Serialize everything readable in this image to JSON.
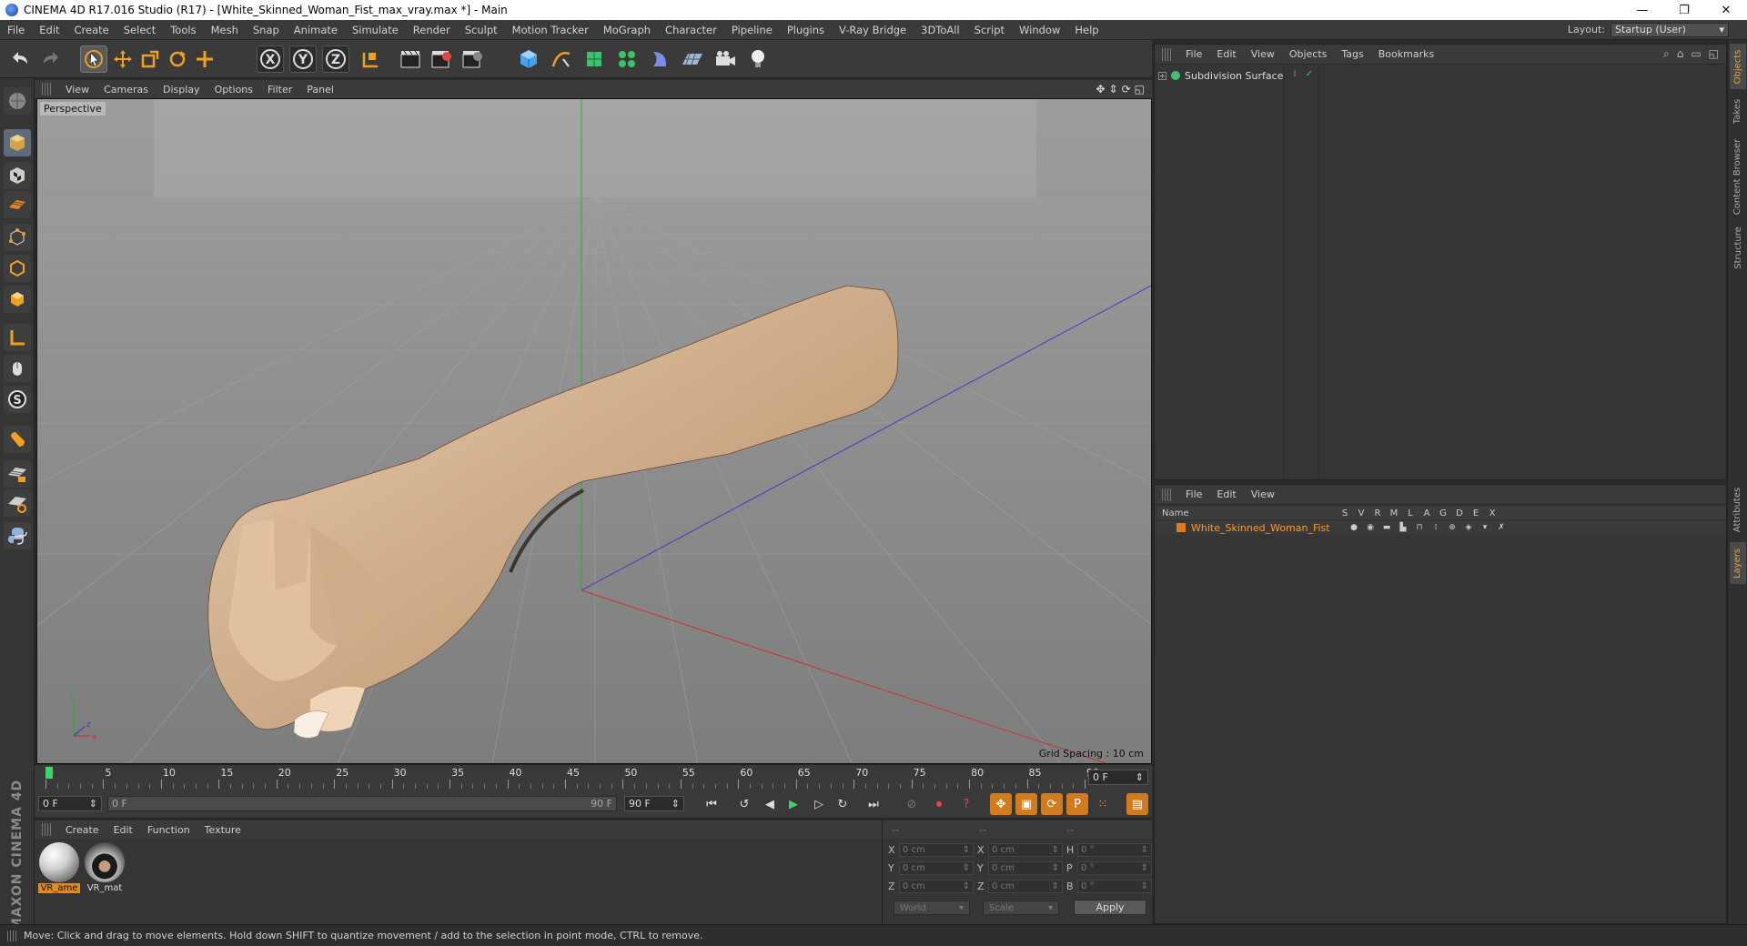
{
  "window": {
    "title": "CINEMA 4D R17.016 Studio (R17) - [White_Skinned_Woman_Fist_max_vray.max *] - Main",
    "minimize": "—",
    "restore": "❐",
    "close": "✕"
  },
  "menu": {
    "items": [
      "File",
      "Edit",
      "Create",
      "Select",
      "Tools",
      "Mesh",
      "Snap",
      "Animate",
      "Simulate",
      "Render",
      "Sculpt",
      "Motion Tracker",
      "MoGraph",
      "Character",
      "Pipeline",
      "Plugins",
      "V-Ray Bridge",
      "3DToAll",
      "Script",
      "Window",
      "Help"
    ],
    "layout_label": "Layout:",
    "layout_value": "Startup (User)"
  },
  "toolbar": {
    "icons": [
      "undo-icon",
      "redo-icon",
      "select-arrow-icon",
      "move-icon",
      "scale-icon",
      "rotate-icon",
      "transform-icon",
      "x-axis-icon",
      "y-axis-icon",
      "z-axis-icon",
      "coordinate-system-icon",
      "render-view-icon",
      "render-picture-viewer-icon",
      "render-settings-icon",
      "cube-icon",
      "spline-pen-icon",
      "subdivision-icon",
      "cloner-icon",
      "deformer-icon",
      "floor-icon",
      "camera-icon",
      "light-icon"
    ],
    "x_label": "X",
    "y_label": "Y",
    "z_label": "Z"
  },
  "viewport": {
    "menu": [
      "View",
      "Cameras",
      "Display",
      "Options",
      "Filter",
      "Panel"
    ],
    "label": "Perspective",
    "grid_spacing": "Grid Spacing : 10 cm",
    "axis_x": "x",
    "axis_y": "y",
    "axis_z": "z"
  },
  "timeline": {
    "labels": [
      "0",
      "5",
      "10",
      "15",
      "20",
      "25",
      "30",
      "35",
      "40",
      "45",
      "50",
      "55",
      "60",
      "65",
      "70",
      "75",
      "80",
      "85",
      "90"
    ],
    "current_frame": "0 F",
    "start_field": "0 F",
    "range_start": "0 F",
    "range_end": "90 F",
    "end_field": "90 F"
  },
  "materials": {
    "menu": [
      "Create",
      "Edit",
      "Function",
      "Texture"
    ],
    "items": [
      {
        "label": "VR_ame"
      },
      {
        "label": "VR_mat"
      }
    ]
  },
  "coords": {
    "headers": [
      "--",
      "--",
      "--"
    ],
    "rows": [
      {
        "axis": "X",
        "pos": "0 cm",
        "axis2": "X",
        "size": "0 cm",
        "axis3": "H",
        "rot": "0 °"
      },
      {
        "axis": "Y",
        "pos": "0 cm",
        "axis2": "Y",
        "size": "0 cm",
        "axis3": "P",
        "rot": "0 °"
      },
      {
        "axis": "Z",
        "pos": "0 cm",
        "axis2": "Z",
        "size": "0 cm",
        "axis3": "B",
        "rot": "0 °"
      }
    ],
    "world": "World",
    "scale": "Scale",
    "apply": "Apply"
  },
  "objects": {
    "menu": [
      "File",
      "Edit",
      "View",
      "Objects",
      "Tags",
      "Bookmarks"
    ],
    "item": "Subdivision Surface"
  },
  "layers": {
    "menu": [
      "File",
      "Edit",
      "View"
    ],
    "header_name": "Name",
    "columns": [
      "S",
      "V",
      "R",
      "M",
      "L",
      "A",
      "G",
      "D",
      "E",
      "X"
    ],
    "item": "White_Skinned_Woman_Fist"
  },
  "side_tabs": [
    "Objects",
    "Takes",
    "Content Browser",
    "Structure",
    "Attributes",
    "Layers"
  ],
  "status": "Move: Click and drag to move elements. Hold down SHIFT to quantize movement / add to the selection in point mode, CTRL to remove.",
  "logo": "MAXON CINEMA 4D",
  "colors": {
    "accent_orange": "#e28a1a",
    "playhead_green": "#3bd36a",
    "x_axis_red": "#c0392b",
    "y_axis_green": "#2eaa3e",
    "z_axis_blue": "#3a3fc8"
  }
}
